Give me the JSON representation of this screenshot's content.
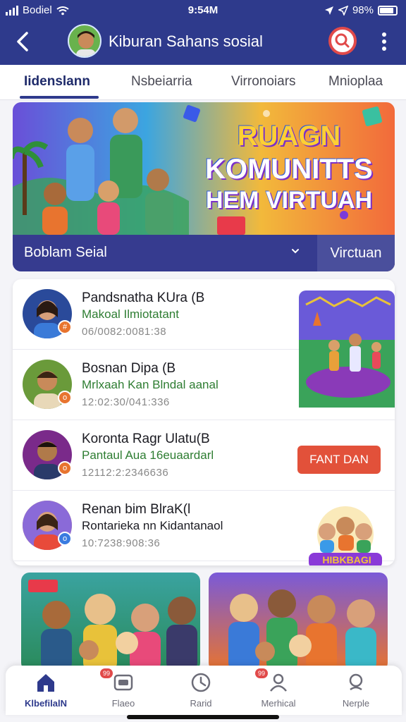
{
  "status": {
    "carrier": "Bodiel",
    "time": "9:54M",
    "battery_text": "98%",
    "battery_level": 0.85
  },
  "header": {
    "title": "Kiburan Sahans sosial",
    "avatar": "avatar",
    "icons": {
      "back": "back-icon",
      "search": "search-icon",
      "more": "more-vert-icon"
    }
  },
  "tabs": [
    {
      "label": "Iidenslann",
      "active": true
    },
    {
      "label": "Nsbeiarria",
      "active": false
    },
    {
      "label": "Virronoiars",
      "active": false
    },
    {
      "label": "Mnioplaa",
      "active": false
    }
  ],
  "banner": {
    "line1": "RUAGN",
    "line2": "KOMUNITTS",
    "line3": "HEM VIRTUAH",
    "footer_label": "Boblam Seial",
    "footer_tab": "Virctuan"
  },
  "list": [
    {
      "name": "Pandsnatha KUra (B",
      "message": "Makoal Ilmiotatant",
      "time": "06/0082:0081:38",
      "badge_color": "#e8742f",
      "avatar_bg": "#2a4a9a"
    },
    {
      "name": "Bosnan Dipa (B",
      "message": "Mrlxaah Kan Blndal aanal",
      "time": "12:02:30/041:336",
      "badge_color": "#e8742f",
      "avatar_bg": "#6a9a3a"
    },
    {
      "name": "Koronta Ragr Ulatu(B",
      "message": "Pantaul Aua 16euaardarl",
      "time": "12112:2:2346636",
      "badge_color": "#e8742f",
      "avatar_bg": "#7a2a8a",
      "cta": "FANT DAN"
    },
    {
      "name": "Renan bim BlraK(l",
      "message": "Rontarieka nn Kidantanaol",
      "time": "10:7238:908:36",
      "badge_color": "#3a7be0",
      "avatar_bg": "#e6a43a"
    }
  ],
  "illustration_label": "HIBKBAGI",
  "bottom_nav": [
    {
      "label": "KlbefilalN",
      "icon": "home-icon",
      "active": true,
      "badge": ""
    },
    {
      "label": "Flaeo",
      "icon": "chat-icon",
      "active": false,
      "badge": "99"
    },
    {
      "label": "Rarid",
      "icon": "clock-icon",
      "active": false,
      "badge": ""
    },
    {
      "label": "Merhical",
      "icon": "person-chat-icon",
      "active": false,
      "badge": "99"
    },
    {
      "label": "Nerple",
      "icon": "people-icon",
      "active": false,
      "badge": ""
    }
  ]
}
